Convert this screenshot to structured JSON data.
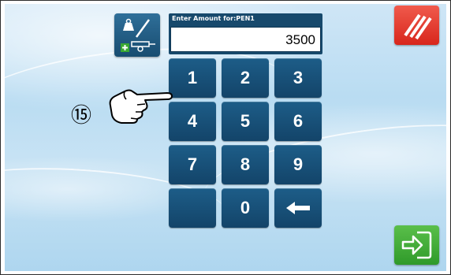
{
  "entry": {
    "label": "Enter Amount for:PEN1",
    "value": "3500"
  },
  "keypad": {
    "keys": [
      "1",
      "2",
      "3",
      "4",
      "5",
      "6",
      "7",
      "8",
      "9",
      "",
      "0"
    ],
    "backspace_icon": "arrow-left-icon"
  },
  "buttons": {
    "weigh_icon": "weight-scale-trailer-icon",
    "cancel_icon": "cancel-slashes-icon",
    "confirm_icon": "enter-arrow-icon"
  },
  "callout": {
    "number": "⑮",
    "icon": "pointing-hand-icon"
  },
  "colors": {
    "key_blue": "#17496c",
    "cancel_red": "#d8261c",
    "confirm_green": "#2f9a2a"
  }
}
